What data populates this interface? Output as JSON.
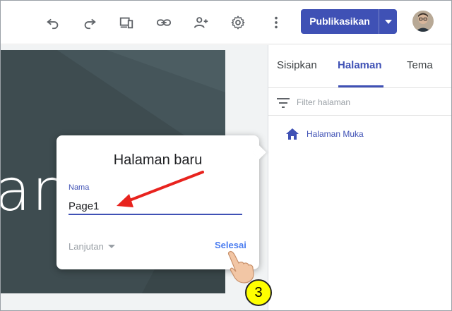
{
  "toolbar": {
    "publish_label": "Publikasikan",
    "icons": [
      "undo-icon",
      "redo-icon",
      "device-preview-icon",
      "link-icon",
      "add-person-icon",
      "gear-icon",
      "more-vert-icon"
    ]
  },
  "canvas": {
    "hero_text": "an"
  },
  "panel": {
    "tabs": [
      {
        "label": "Sisipkan"
      },
      {
        "label": "Halaman"
      },
      {
        "label": "Tema"
      }
    ],
    "filter_placeholder": "Filter halaman",
    "pages": [
      {
        "label": "Halaman Muka"
      }
    ]
  },
  "dialog": {
    "title": "Halaman baru",
    "name_label": "Nama",
    "name_value": "Page1",
    "advanced_label": "Lanjutan",
    "done_label": "Selesai"
  },
  "annotation": {
    "step_number": "3"
  },
  "colors": {
    "accent": "#3f51b5",
    "hero_bg": "#3e4c50",
    "annotation_arrow": "#e8231e",
    "badge": "#ffff00"
  }
}
